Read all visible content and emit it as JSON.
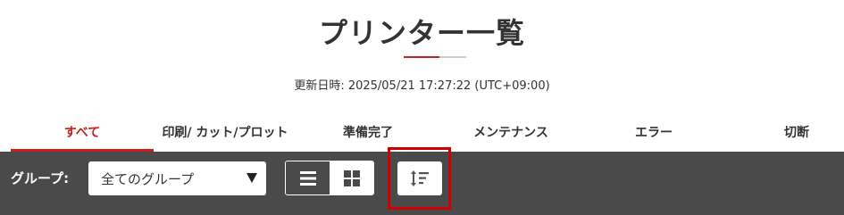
{
  "page": {
    "title": "プリンター一覧",
    "updated_label": "更新日時: 2025/05/21 17:27:22 (UTC+09:00)"
  },
  "tabs": [
    {
      "label": "すべて",
      "active": true
    },
    {
      "label": "印刷/ カット/プロット",
      "active": false
    },
    {
      "label": "準備完了",
      "active": false
    },
    {
      "label": "メンテナンス",
      "active": false
    },
    {
      "label": "エラー",
      "active": false
    },
    {
      "label": "切断",
      "active": false
    }
  ],
  "toolbar": {
    "group_label": "グループ:",
    "group_select_value": "全てのグループ",
    "view_buttons": [
      "list-view-icon",
      "grid-view-icon"
    ],
    "sort_icon": "sort-icon"
  },
  "colors": {
    "accent": "#c81e1e",
    "toolbar_bg": "#4a4a4a",
    "highlight_frame": "#d00000"
  }
}
